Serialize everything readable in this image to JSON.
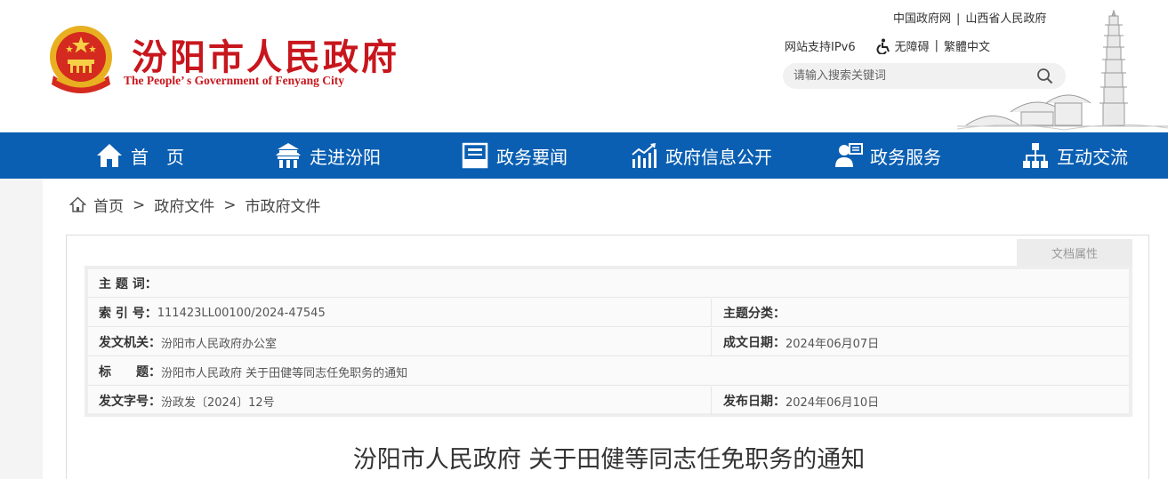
{
  "header": {
    "title": "汾阳市人民政府",
    "subtitle": "The People’ s Government of Fenyang City",
    "top_links": [
      "中国政府网",
      "山西省人民政府"
    ],
    "ipv6": "网站支持IPv6",
    "accessibility": "无障碍",
    "language": "繁體中文",
    "search_placeholder": "请输入搜索关键词"
  },
  "nav": {
    "items": [
      {
        "label": "首　页",
        "icon": "home-icon"
      },
      {
        "label": "走进汾阳",
        "icon": "gate-icon"
      },
      {
        "label": "政务要闻",
        "icon": "news-icon"
      },
      {
        "label": "政府信息公开",
        "icon": "chart-icon"
      },
      {
        "label": "政务服务",
        "icon": "service-icon"
      },
      {
        "label": "互动交流",
        "icon": "network-icon"
      }
    ]
  },
  "breadcrumb": [
    "首页",
    "政府文件",
    "市政府文件"
  ],
  "doc_attr_tab": "文档属性",
  "meta": {
    "subject_words_label": "主 题 词：",
    "subject_words_value": "",
    "index_label": "索 引 号：",
    "index_value": "111423LL00100/2024-47545",
    "topic_label": "主题分类：",
    "topic_value": "",
    "issuer_label": "发文机关：",
    "issuer_value": "汾阳市人民政府办公室",
    "created_label": "成文日期：",
    "created_value": "2024年06月07日",
    "title_label": "标　　题：",
    "title_value": "汾阳市人民政府 关于田健等同志任免职务的通知",
    "docno_label": "发文字号：",
    "docno_value": "汾政发〔2024〕12号",
    "published_label": "发布日期：",
    "published_value": "2024年06月10日"
  },
  "document_title": "汾阳市人民政府 关于田健等同志任免职务的通知",
  "colors": {
    "brand_red": "#c8161d",
    "nav_blue": "#0a5fb2"
  }
}
